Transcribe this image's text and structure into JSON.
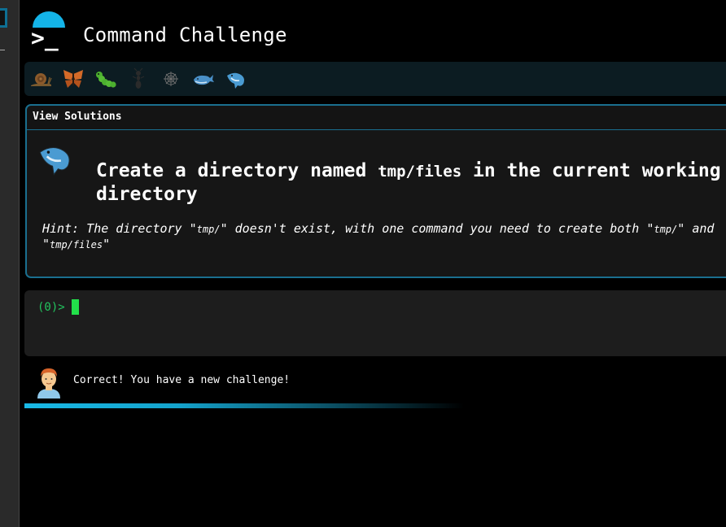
{
  "app": {
    "title": "Command Challenge"
  },
  "levels": [
    {
      "icon": "snail-icon"
    },
    {
      "icon": "butterfly-icon"
    },
    {
      "icon": "caterpillar-icon"
    },
    {
      "icon": "ant-icon"
    },
    {
      "icon": "spider-web-icon"
    },
    {
      "icon": "whale-icon"
    },
    {
      "icon": "spouting-whale-icon"
    }
  ],
  "panel": {
    "view_solutions_label": "View Solutions",
    "task_prefix": "Create a directory named ",
    "task_code": "tmp/files",
    "task_suffix": " in the current working directory",
    "hint_label": "Hint:",
    "hint_part1": " The directory \"",
    "hint_code1": "tmp/",
    "hint_part2": "\" doesn't exist, with one command you need to create both \"",
    "hint_code2": "tmp/",
    "hint_part3": "\" and \"",
    "hint_code3": "tmp/files",
    "hint_part4": "\""
  },
  "terminal": {
    "prompt": "(0)>",
    "input_value": ""
  },
  "message": {
    "text": "Correct! You have a new challenge!"
  },
  "colors": {
    "accent": "#14b4e8",
    "panel_border": "#1a6f8f",
    "prompt": "#22c55e",
    "cursor": "#22e04a"
  }
}
